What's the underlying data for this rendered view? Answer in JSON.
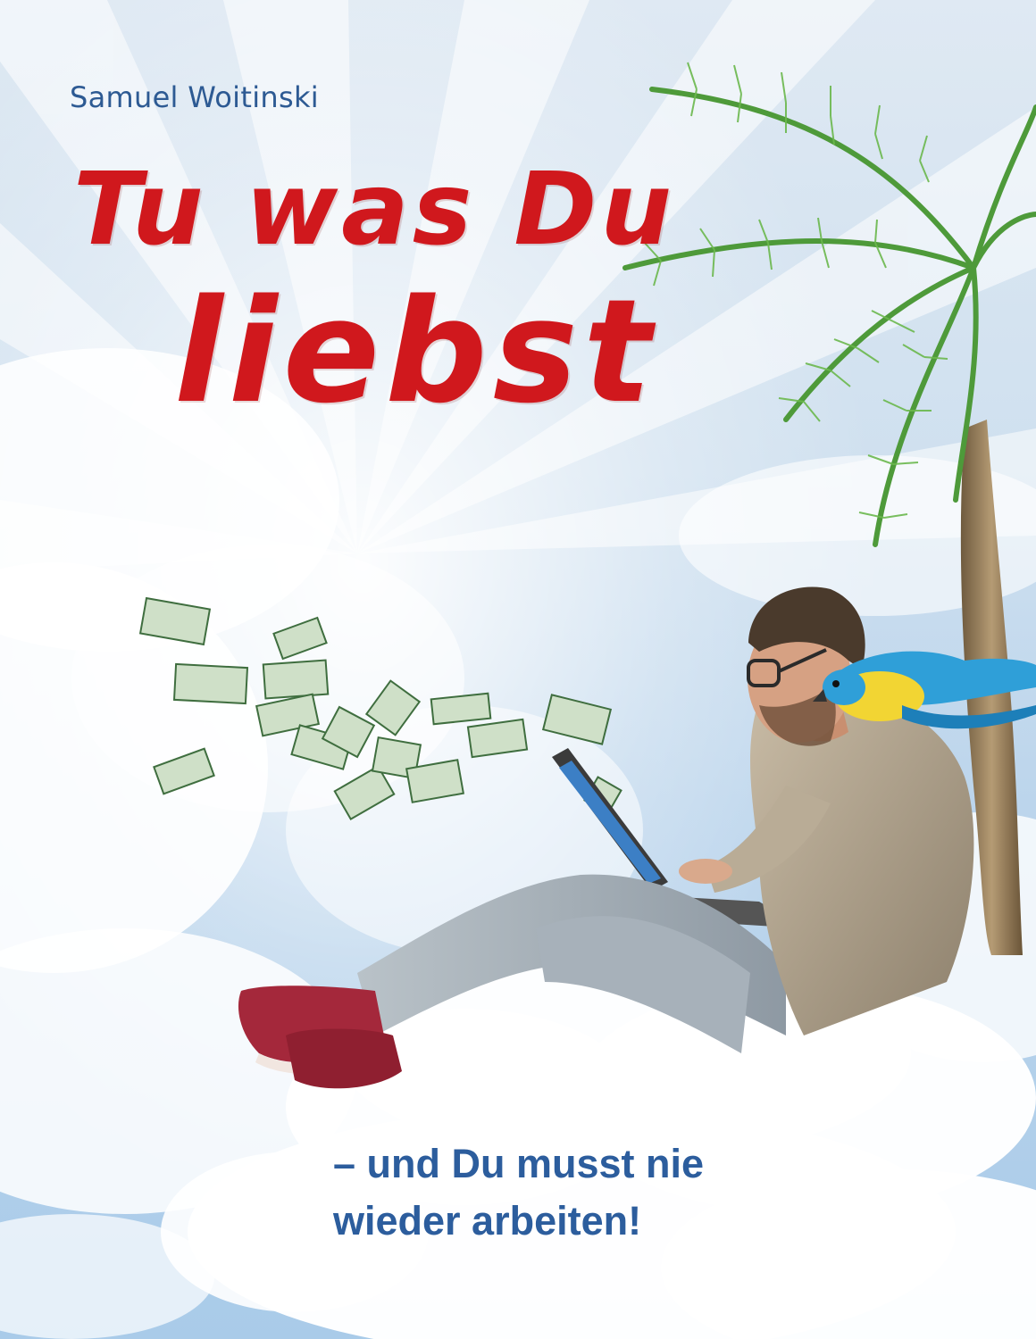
{
  "book": {
    "author": "Samuel Woitinski",
    "title_line1": "Tu was Du",
    "title_line2": "liebst",
    "subtitle_line1": "– und Du musst nie",
    "subtitle_line2": "wieder arbeiten!"
  },
  "colors": {
    "sky": "#bcd5ec",
    "title_red": "#d0181d",
    "author_blue": "#2d5a93",
    "subtitle_blue": "#2c5d9d",
    "palm_green": "#4e9a3a",
    "money_green": "#5a8a5a",
    "parrot_blue": "#2f9fd8",
    "parrot_yellow": "#f2d533",
    "shoe_red": "#a4283b"
  },
  "illustration": {
    "elements": [
      "sun-rays",
      "clouds",
      "palm-tree",
      "flying-money",
      "man-with-laptop",
      "parrot",
      "red-sneakers"
    ]
  }
}
